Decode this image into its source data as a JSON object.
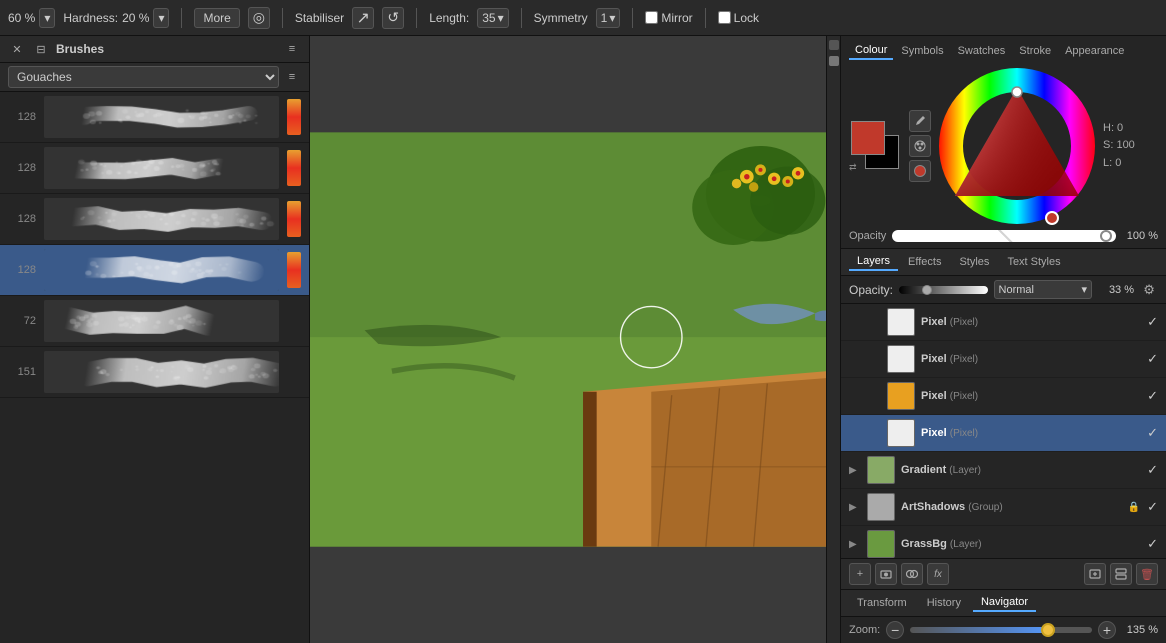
{
  "toolbar": {
    "size_label": "60 %",
    "size_dropdown_arrow": "▾",
    "hardness_label": "Hardness:",
    "hardness_value": "20 %",
    "hardness_dropdown_arrow": "▾",
    "more_button": "More",
    "stabilizer_label": "Stabiliser",
    "length_label": "Length:",
    "length_value": "35",
    "symmetry_label": "Symmetry",
    "symmetry_value": "1",
    "mirror_label": "Mirror",
    "lock_label": "Lock"
  },
  "brushes_panel": {
    "title": "Brushes",
    "category": "Gouaches",
    "items": [
      {
        "number": "128",
        "selected": false,
        "has_color": true
      },
      {
        "number": "128",
        "selected": false,
        "has_color": true
      },
      {
        "number": "128",
        "selected": false,
        "has_color": true
      },
      {
        "number": "128",
        "selected": true,
        "has_color": true
      },
      {
        "number": "72",
        "selected": false,
        "has_color": false
      },
      {
        "number": "151",
        "selected": false,
        "has_color": false
      }
    ]
  },
  "colour_panel": {
    "tabs": [
      "Colour",
      "Symbols",
      "Swatches",
      "Stroke",
      "Appearance"
    ],
    "active_tab": "Colour",
    "hsl": {
      "h": "H: 0",
      "s": "S: 100",
      "l": "L: 0"
    },
    "opacity_label": "Opacity",
    "opacity_value": "100 %"
  },
  "layers_panel": {
    "tabs": [
      "Layers",
      "Effects",
      "Styles",
      "Text Styles"
    ],
    "active_tab": "Layers",
    "opacity_label": "Opacity:",
    "opacity_value": "33 %",
    "blend_mode": "Normal",
    "layers": [
      {
        "name": "Pixel",
        "type": "(Pixel)",
        "indent": 1,
        "selected": false,
        "thumb_color": "#eee",
        "visible": true,
        "locked": false
      },
      {
        "name": "Pixel",
        "type": "(Pixel)",
        "indent": 1,
        "selected": false,
        "thumb_color": "#eee",
        "visible": true,
        "locked": false
      },
      {
        "name": "Pixel",
        "type": "(Pixel)",
        "indent": 1,
        "selected": false,
        "thumb_color": "#e8a020",
        "visible": true,
        "locked": false
      },
      {
        "name": "Pixel",
        "type": "(Pixel)",
        "indent": 1,
        "selected": true,
        "thumb_color": "#eee",
        "visible": true,
        "locked": false
      },
      {
        "name": "Gradient",
        "type": "(Layer)",
        "indent": 0,
        "selected": false,
        "thumb_color": "#88aa66",
        "visible": true,
        "locked": false,
        "expandable": true
      },
      {
        "name": "ArtShadows",
        "type": "(Group)",
        "indent": 0,
        "selected": false,
        "thumb_color": "#aaa",
        "visible": true,
        "locked": true,
        "expandable": true
      },
      {
        "name": "GrassBg",
        "type": "(Layer)",
        "indent": 0,
        "selected": false,
        "thumb_color": "#6a9a40",
        "visible": true,
        "locked": false,
        "expandable": true
      }
    ]
  },
  "navigator": {
    "zoom_label": "Zoom:",
    "zoom_value": "135 %",
    "minus_icon": "−",
    "plus_icon": "+"
  },
  "bottom_tabs": [
    "Transform",
    "History",
    "Navigator"
  ],
  "active_bottom_tab": "Navigator"
}
